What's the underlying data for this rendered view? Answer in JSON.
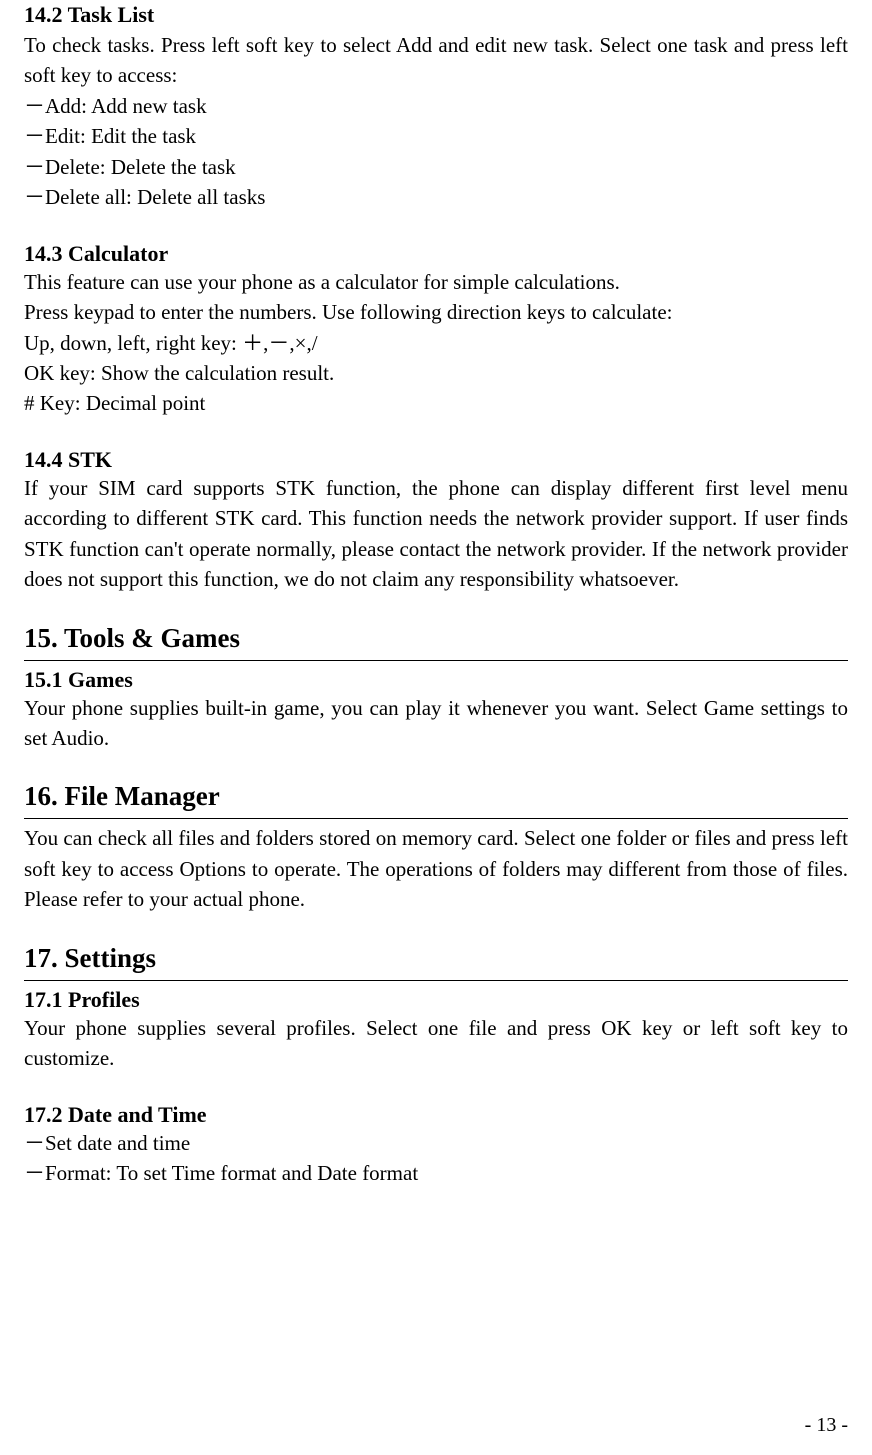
{
  "s142": {
    "title": "14.2 Task List",
    "intro": "To check tasks. Press left soft key to select Add and edit new task. Select one task and press left soft key to access:",
    "items": [
      "－Add: Add new task",
      "－Edit: Edit the task",
      "－Delete: Delete the task",
      "－Delete all: Delete all tasks"
    ]
  },
  "s143": {
    "title": "14.3 Calculator",
    "lines": [
      "This feature can use your phone as a calculator for simple calculations.",
      "Press keypad to enter the numbers. Use following direction keys to calculate:",
      "Up, down, left, right key:  ＋,－,×,/",
      "OK key: Show the calculation result.",
      "# Key: Decimal point"
    ]
  },
  "s144": {
    "title": "14.4 STK",
    "body": "If your SIM card supports STK function, the phone can display different first level menu according to different STK card. This function needs the network provider support. If user finds STK function can't operate normally, please contact the network provider. If the network provider does not support this function, we do not claim any responsibility whatsoever."
  },
  "s15": {
    "title": "15. Tools & Games"
  },
  "s151": {
    "title": "15.1 Games",
    "body": "Your phone supplies built-in game, you can play it whenever you want. Select Game settings to set Audio."
  },
  "s16": {
    "title": "16. File Manager",
    "body": "You can check all files and folders stored on memory card. Select one folder or files and press left soft key to access Options to operate. The operations of folders may different from those of files. Please refer to your actual phone."
  },
  "s17": {
    "title": "17. Settings"
  },
  "s171": {
    "title": "17.1 Profiles",
    "body": "Your phone supplies several profiles. Select one file and press OK key or left soft key to customize."
  },
  "s172": {
    "title": "17.2 Date and Time",
    "items": [
      "－Set date and time",
      "－Format: To set Time format and Date format"
    ]
  },
  "pagenum": "- 13 -"
}
